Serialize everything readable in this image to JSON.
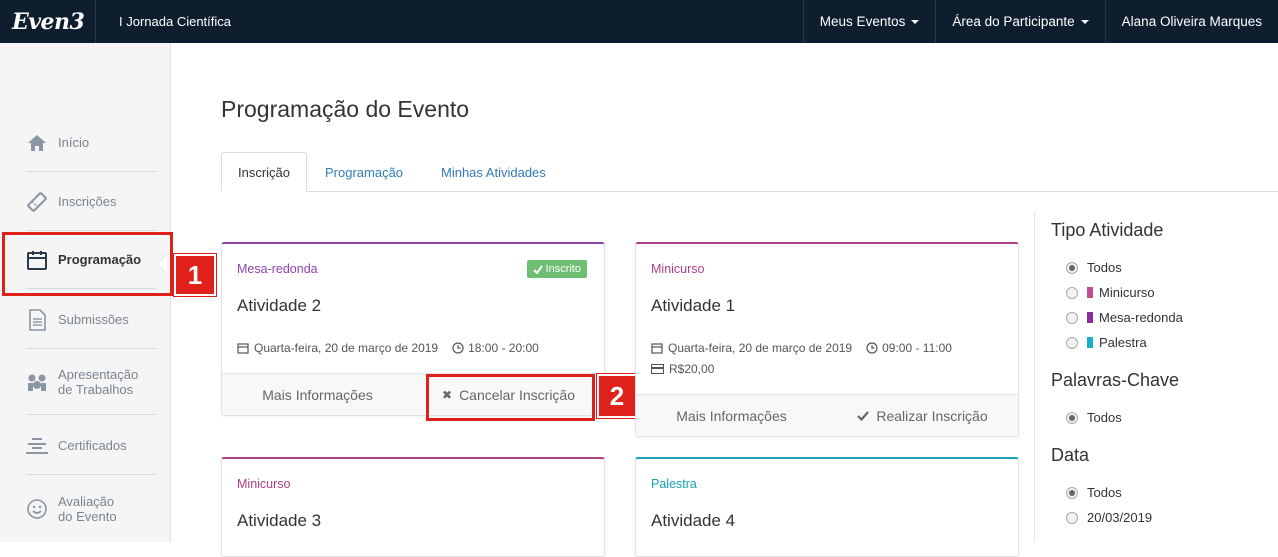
{
  "app": {
    "logo": "Even3",
    "event_name": "I Jornada Científica"
  },
  "topnav": {
    "meus_eventos": "Meus Eventos",
    "area_participante": "Área do Participante",
    "user_name": "Alana Oliveira Marques"
  },
  "sidebar": {
    "items": [
      {
        "label": "Início",
        "icon": "home-icon"
      },
      {
        "label": "Inscrições",
        "icon": "ticket-icon"
      },
      {
        "label": "Programação",
        "icon": "calendar-icon",
        "active": true
      },
      {
        "label": "Submissões",
        "icon": "document-icon"
      },
      {
        "label": "Apresentação de Trabalhos",
        "label_line1": "Apresentação",
        "label_line2": "de Trabalhos",
        "icon": "presentation-icon"
      },
      {
        "label": "Certificados",
        "icon": "certificate-icon"
      },
      {
        "label": "Avaliação do Evento",
        "label_line1": "Avaliação",
        "label_line2": "do Evento",
        "icon": "smiley-icon"
      }
    ]
  },
  "annotations": {
    "step1": "1",
    "step2": "2"
  },
  "page": {
    "title": "Programação do Evento",
    "tabs": [
      {
        "label": "Inscrição",
        "active": true
      },
      {
        "label": "Programação"
      },
      {
        "label": "Minhas Atividades"
      }
    ]
  },
  "cards": [
    {
      "type": "Mesa-redonda",
      "type_color": "#8e44ad",
      "title": "Atividade 2",
      "date": "Quarta-feira, 20 de março de 2019",
      "time": "18:00 - 20:00",
      "status": "Inscrito",
      "more_label": "Mais Informações",
      "action_label": "Cancelar Inscrição"
    },
    {
      "type": "Minicurso",
      "type_color": "#b0408a",
      "title": "Atividade 1",
      "date": "Quarta-feira, 20 de março de 2019",
      "time": "09:00 - 11:00",
      "price": "R$20,00",
      "more_label": "Mais Informações",
      "action_label": "Realizar Inscrição"
    },
    {
      "type": "Minicurso",
      "type_color": "#b0408a",
      "title": "Atividade 3"
    },
    {
      "type": "Palestra",
      "type_color": "#17a2b8",
      "title": "Atividade 4"
    }
  ],
  "filters": {
    "tipo_atividade": {
      "title": "Tipo Atividade",
      "options": [
        {
          "label": "Todos",
          "selected": true
        },
        {
          "label": "Minicurso",
          "color": "#c0508f"
        },
        {
          "label": "Mesa-redonda",
          "color": "#8e2b9e"
        },
        {
          "label": "Palestra",
          "color": "#1ab0c8"
        }
      ]
    },
    "palavras_chave": {
      "title": "Palavras-Chave",
      "options": [
        {
          "label": "Todos",
          "selected": true
        }
      ]
    },
    "data": {
      "title": "Data",
      "options": [
        {
          "label": "Todos",
          "selected": true
        },
        {
          "label": "20/03/2019"
        }
      ]
    }
  }
}
